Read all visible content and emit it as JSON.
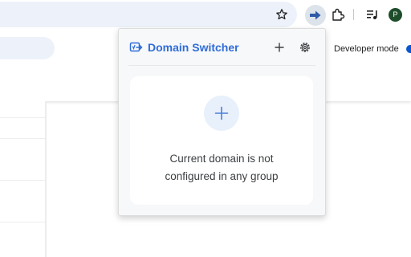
{
  "browser": {
    "toolbar_icons": [
      "star-icon",
      "extension-arrow-icon",
      "puzzle-icon",
      "media-icon"
    ],
    "profile_initial": "P"
  },
  "page": {
    "developer_mode_label": "Developer mode",
    "developer_mode_on": true
  },
  "popup": {
    "title": "Domain Switcher",
    "accent_color": "#2f6dd8",
    "header_icons": [
      "domain-switcher-icon",
      "plus-icon",
      "gear-icon"
    ],
    "empty_state": {
      "line1": "Current domain is not",
      "line2": "configured in any group"
    }
  }
}
